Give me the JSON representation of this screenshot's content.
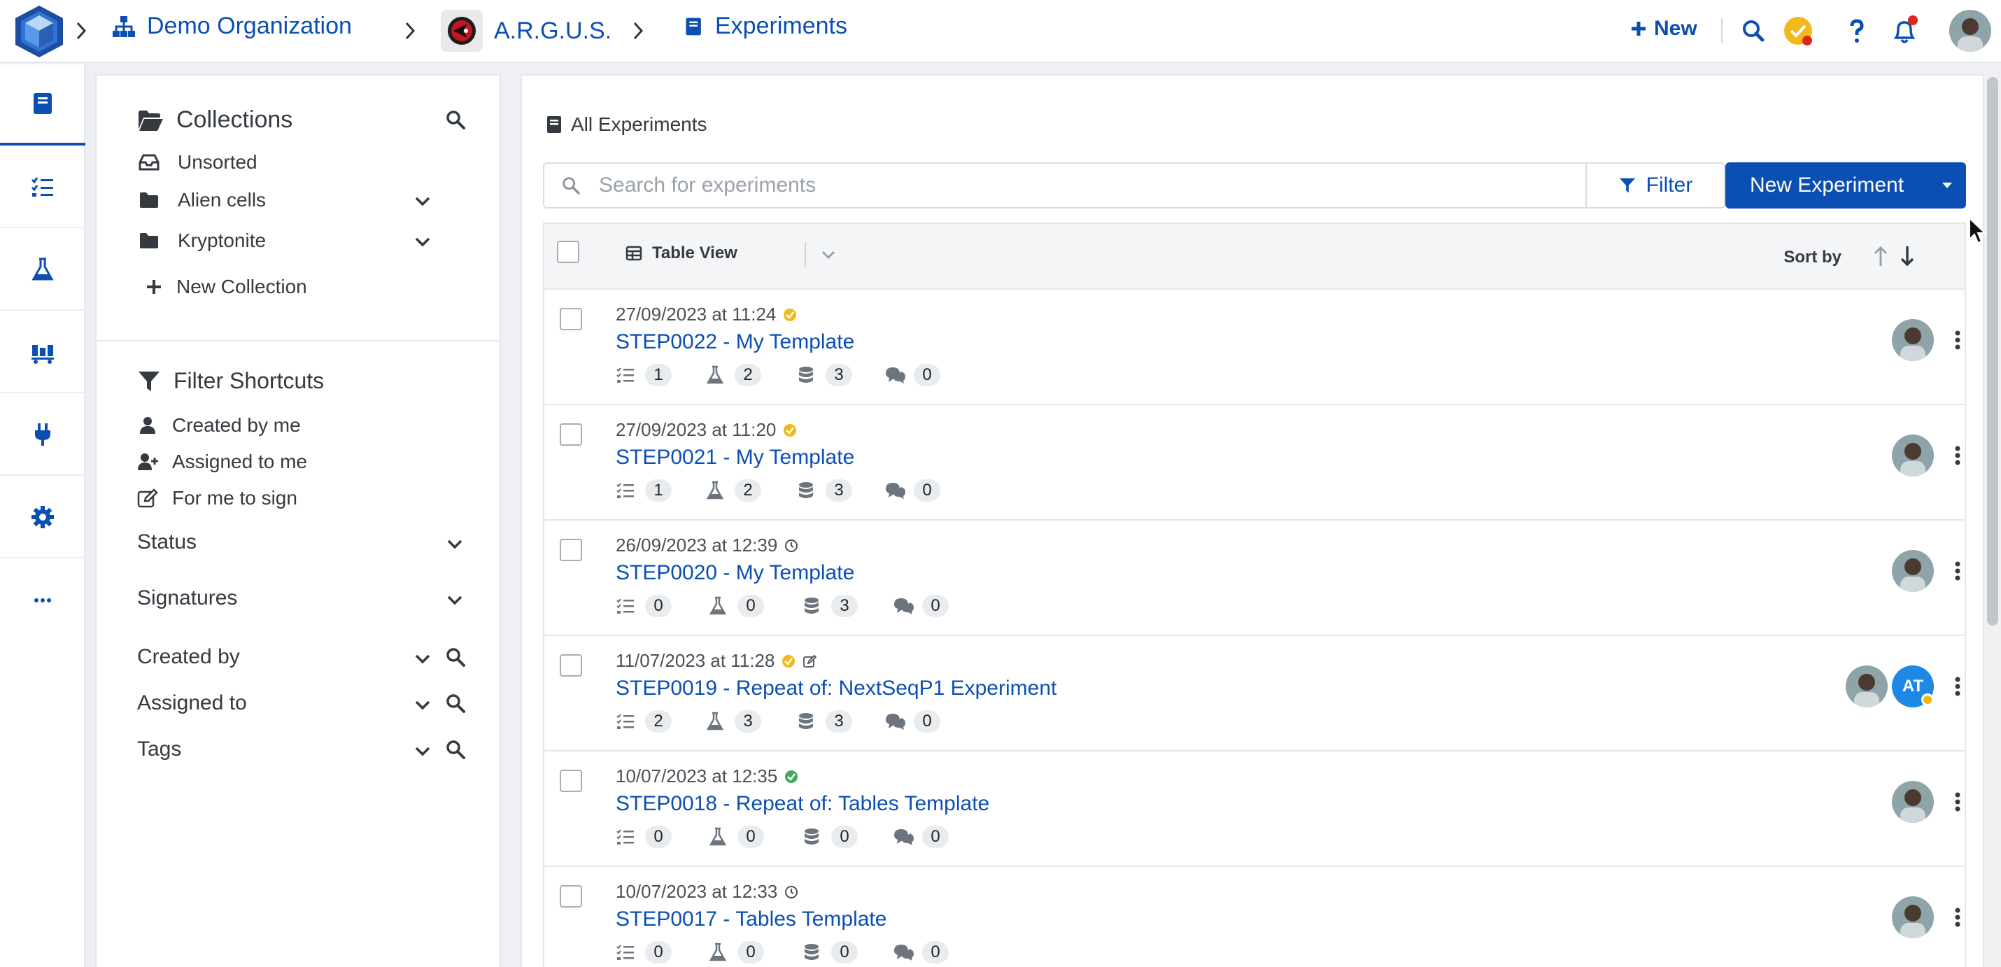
{
  "breadcrumb": {
    "organization": "Demo Organization",
    "project": "A.R.G.U.S.",
    "section": "Experiments"
  },
  "topbar": {
    "new_label": "New"
  },
  "colors": {
    "brand": "#0b4fb3",
    "status_yellow": "#f2b91c",
    "status_green": "#3fae5a",
    "notification_red": "#e0241b"
  },
  "collections": {
    "title": "Collections",
    "items": [
      {
        "label": "Unsorted",
        "icon": "inbox-icon"
      },
      {
        "label": "Alien cells",
        "icon": "folder-icon"
      },
      {
        "label": "Kryptonite",
        "icon": "folder-icon"
      }
    ],
    "new_label": "New Collection"
  },
  "filters": {
    "title": "Filter Shortcuts",
    "shortcuts": [
      {
        "label": "Created by me",
        "icon": "user-icon"
      },
      {
        "label": "Assigned to me",
        "icon": "user-plus-icon"
      },
      {
        "label": "For me to sign",
        "icon": "edit-icon"
      }
    ],
    "sections": [
      "Status",
      "Signatures",
      "Created by",
      "Assigned to",
      "Tags"
    ]
  },
  "main": {
    "heading": "All Experiments",
    "search_placeholder": "Search for experiments",
    "filter_label": "Filter",
    "new_experiment_label": "New Experiment",
    "table_view_label": "Table View",
    "sort_by_label": "Sort by"
  },
  "experiments": [
    {
      "date": "27/09/2023 at 11:24",
      "status": "signed-yellow",
      "title": "STEP0022 - My Template",
      "steps": "1",
      "samples": "2",
      "data": "3",
      "comments": "0"
    },
    {
      "date": "27/09/2023 at 11:20",
      "status": "signed-yellow",
      "title": "STEP0021 - My Template",
      "steps": "1",
      "samples": "2",
      "data": "3",
      "comments": "0"
    },
    {
      "date": "26/09/2023 at 12:39",
      "status": "clock",
      "title": "STEP0020 - My Template",
      "steps": "0",
      "samples": "0",
      "data": "3",
      "comments": "0"
    },
    {
      "date": "11/07/2023 at 11:28",
      "status": "signed-yellow",
      "title": "STEP0019 - Repeat of: NextSeqP1 Experiment",
      "steps": "2",
      "samples": "3",
      "data": "3",
      "comments": "0",
      "second_avatar": "AT"
    },
    {
      "date": "10/07/2023 at 12:35",
      "status": "signed-green",
      "title": "STEP0018 - Repeat of: Tables Template",
      "steps": "0",
      "samples": "0",
      "data": "0",
      "comments": "0"
    },
    {
      "date": "10/07/2023 at 12:33",
      "status": "clock",
      "title": "STEP0017 - Tables Template",
      "steps": "0",
      "samples": "0",
      "data": "0",
      "comments": "0"
    }
  ]
}
